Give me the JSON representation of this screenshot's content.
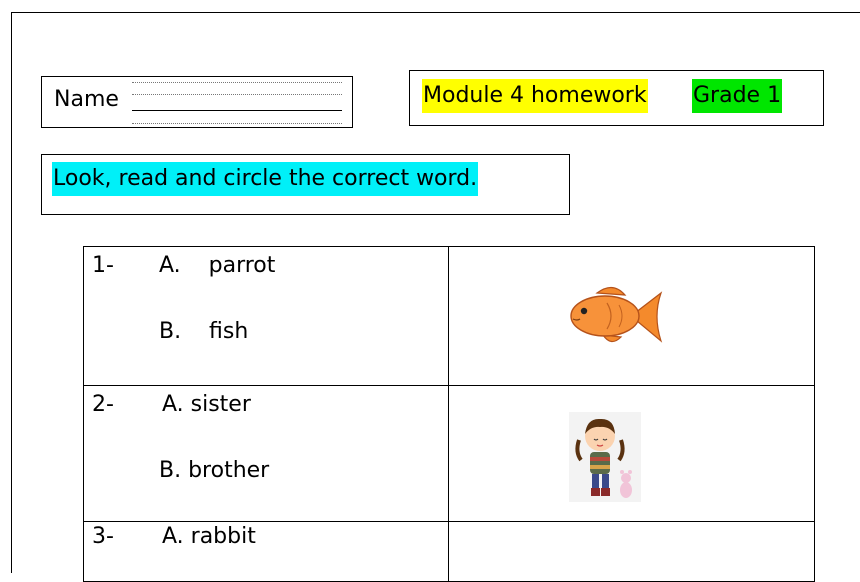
{
  "header": {
    "name_label": "Name",
    "module_title": "Module 4 homework",
    "grade": "Grade 1"
  },
  "instruction": "Look, read and circle the correct word.",
  "questions": [
    {
      "number": "1-",
      "option_a": "A.    parrot",
      "option_b": "B.    fish",
      "image": "goldfish-picture"
    },
    {
      "number": "2-",
      "option_a": "A. sister",
      "option_b": "B. brother",
      "image": "girl-picture"
    },
    {
      "number": "3-",
      "option_a": "A. rabbit",
      "option_b": "",
      "image": ""
    }
  ],
  "colors": {
    "module_highlight": "#ffff00",
    "grade_highlight": "#00e600",
    "instruction_highlight": "#00f0f8"
  }
}
